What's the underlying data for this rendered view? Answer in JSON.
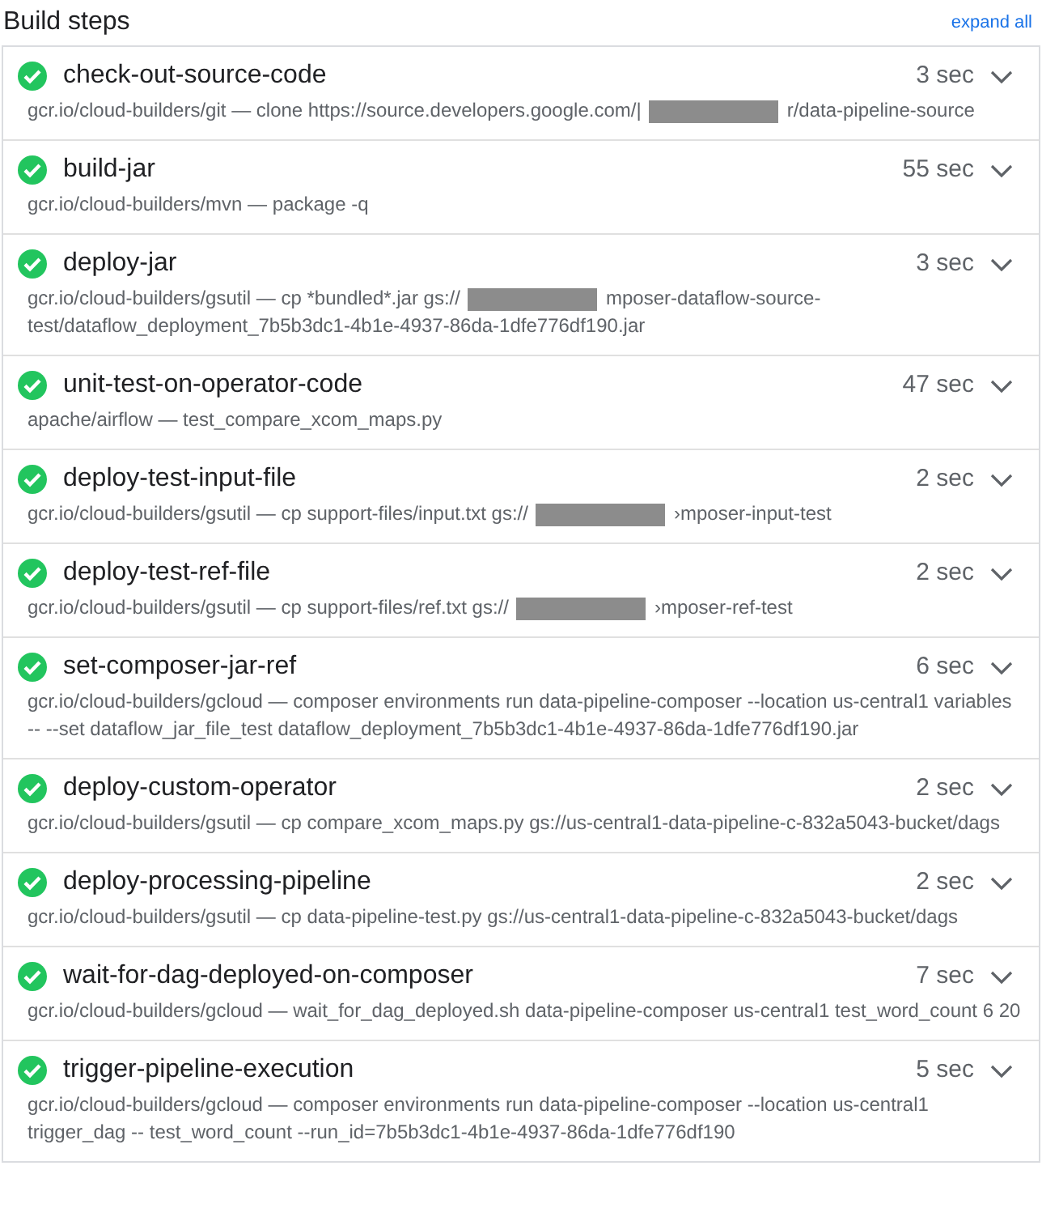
{
  "header": {
    "title": "Build steps",
    "action": "expand all"
  },
  "steps": [
    {
      "name": "check-out-source-code",
      "succeeded": true,
      "duration": "3 sec",
      "expanded": false,
      "detail": [
        {
          "kind": "text",
          "text": "gcr.io/cloud-builders/git — clone https://source.developers.google.com/|"
        },
        {
          "kind": "redacted"
        },
        {
          "kind": "text",
          "text": "r/data-pipeline-source"
        }
      ]
    },
    {
      "name": "build-jar",
      "succeeded": true,
      "duration": "55 sec",
      "expanded": false,
      "detail": [
        {
          "kind": "text",
          "text": "gcr.io/cloud-builders/mvn — package -q"
        }
      ]
    },
    {
      "name": "deploy-jar",
      "succeeded": true,
      "duration": "3 sec",
      "expanded": false,
      "detail": [
        {
          "kind": "text",
          "text": "gcr.io/cloud-builders/gsutil — cp *bundled*.jar gs://"
        },
        {
          "kind": "redacted"
        },
        {
          "kind": "text",
          "text": "mposer-dataflow-source-test/dataflow_deployment_7b5b3dc1-4b1e-4937-86da-1dfe776df190.jar"
        }
      ]
    },
    {
      "name": "unit-test-on-operator-code",
      "succeeded": true,
      "duration": "47 sec",
      "expanded": false,
      "detail": [
        {
          "kind": "text",
          "text": "apache/airflow — test_compare_xcom_maps.py"
        }
      ]
    },
    {
      "name": "deploy-test-input-file",
      "succeeded": true,
      "duration": "2 sec",
      "expanded": false,
      "detail": [
        {
          "kind": "text",
          "text": "gcr.io/cloud-builders/gsutil — cp support-files/input.txt gs://"
        },
        {
          "kind": "redacted"
        },
        {
          "kind": "text",
          "text": "›mposer-input-test"
        }
      ]
    },
    {
      "name": "deploy-test-ref-file",
      "succeeded": true,
      "duration": "2 sec",
      "expanded": false,
      "detail": [
        {
          "kind": "text",
          "text": "gcr.io/cloud-builders/gsutil — cp support-files/ref.txt gs://"
        },
        {
          "kind": "redacted"
        },
        {
          "kind": "text",
          "text": "›mposer-ref-test"
        }
      ]
    },
    {
      "name": "set-composer-jar-ref",
      "succeeded": true,
      "duration": "6 sec",
      "expanded": false,
      "detail": [
        {
          "kind": "text",
          "text": "gcr.io/cloud-builders/gcloud — composer environments run data-pipeline-composer --location us-central1 variables -- --set dataflow_jar_file_test dataflow_deployment_7b5b3dc1-4b1e-4937-86da-1dfe776df190.jar"
        }
      ]
    },
    {
      "name": "deploy-custom-operator",
      "succeeded": true,
      "duration": "2 sec",
      "expanded": false,
      "detail": [
        {
          "kind": "text",
          "text": "gcr.io/cloud-builders/gsutil — cp compare_xcom_maps.py gs://us-central1-data-pipeline-c-832a5043-bucket/dags"
        }
      ]
    },
    {
      "name": "deploy-processing-pipeline",
      "succeeded": true,
      "duration": "2 sec",
      "expanded": false,
      "detail": [
        {
          "kind": "text",
          "text": "gcr.io/cloud-builders/gsutil — cp data-pipeline-test.py gs://us-central1-data-pipeline-c-832a5043-bucket/dags"
        }
      ]
    },
    {
      "name": "wait-for-dag-deployed-on-composer",
      "succeeded": true,
      "duration": "7 sec",
      "expanded": false,
      "detail": [
        {
          "kind": "text",
          "text": "gcr.io/cloud-builders/gcloud — wait_for_dag_deployed.sh data-pipeline-composer us-central1 test_word_count 6 20"
        }
      ]
    },
    {
      "name": "trigger-pipeline-execution",
      "succeeded": true,
      "duration": "5 sec",
      "expanded": false,
      "detail": [
        {
          "kind": "text",
          "text": "gcr.io/cloud-builders/gcloud — composer environments run data-pipeline-composer --location us-central1 trigger_dag -- test_word_count --run_id=7b5b3dc1-4b1e-4937-86da-1dfe776df190"
        }
      ]
    }
  ]
}
